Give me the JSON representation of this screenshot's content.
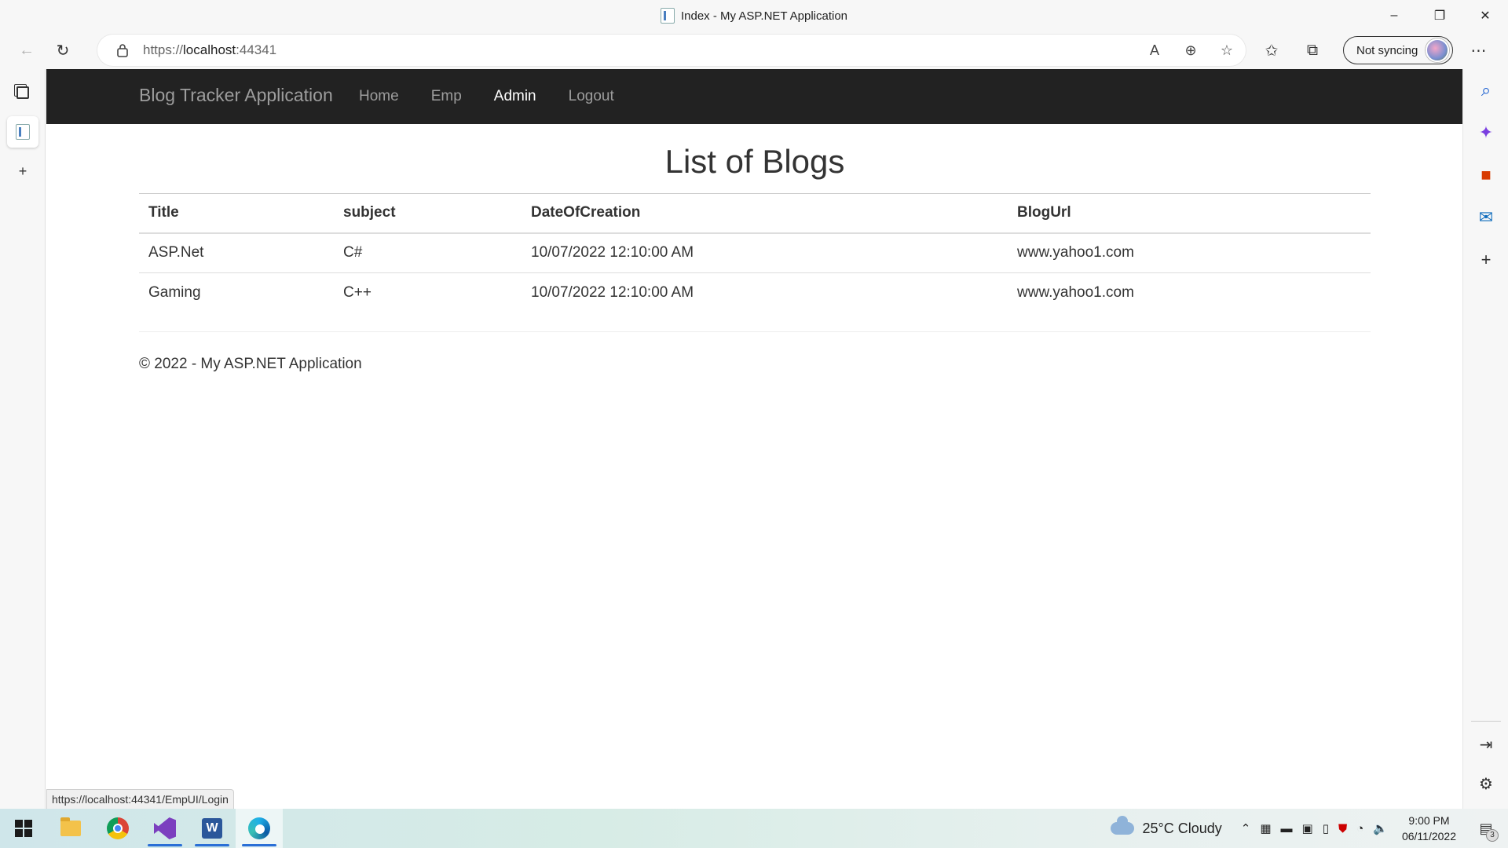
{
  "window": {
    "title": "Index - My ASP.NET Application",
    "controls": {
      "minimize": "–",
      "restore": "❐",
      "close": "✕"
    }
  },
  "toolbar": {
    "url_scheme": "https://",
    "url_host": "localhost",
    "url_port": ":44341",
    "sync_label": "Not syncing"
  },
  "site": {
    "brand": "Blog Tracker Application",
    "nav": [
      {
        "label": "Home",
        "active": false
      },
      {
        "label": "Emp",
        "active": false
      },
      {
        "label": "Admin",
        "active": true
      },
      {
        "label": "Logout",
        "active": false
      }
    ],
    "heading": "List of Blogs",
    "table": {
      "headers": [
        "Title",
        "subject",
        "DateOfCreation",
        "BlogUrl"
      ],
      "rows": [
        [
          "ASP.Net",
          "C#",
          "10/07/2022 12:10:00 AM",
          "www.yahoo1.com"
        ],
        [
          "Gaming",
          "C++",
          "10/07/2022 12:10:00 AM",
          "www.yahoo1.com"
        ]
      ]
    },
    "footer": "© 2022 - My ASP.NET Application"
  },
  "status_bar_url": "https://localhost:44341/EmpUI/Login",
  "taskbar": {
    "weather": "25°C  Cloudy",
    "time": "9:00 PM",
    "date": "06/11/2022",
    "notification_count": "3"
  },
  "colors": {
    "navbar_bg": "#222222",
    "nav_link": "#9d9d9d",
    "nav_active": "#ffffff",
    "edge_accent": "#2a6fd6"
  }
}
